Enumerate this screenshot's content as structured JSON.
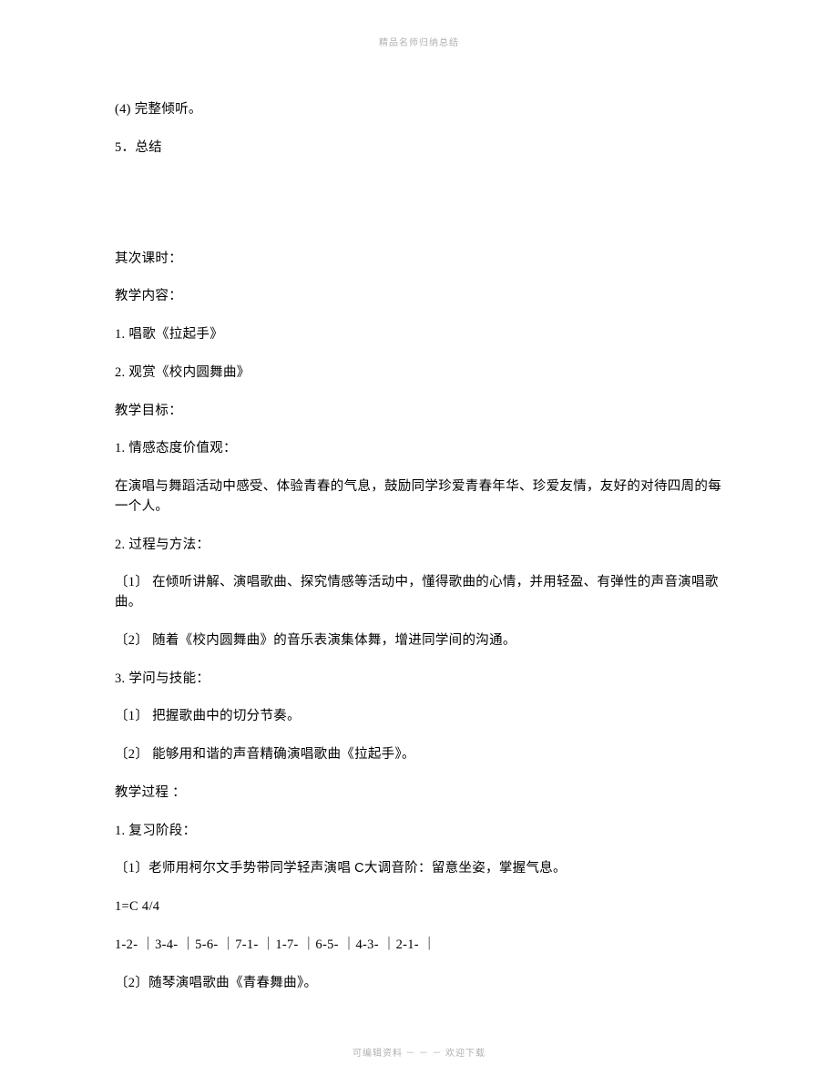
{
  "header_watermark": "精品名师归纳总结",
  "footer_watermark": "可编辑资料   －  －  －  欢迎下载",
  "lines": {
    "l1": "(4)    完整倾听。",
    "l2": "5．总结",
    "l3": "其次课时：",
    "l4": "教学内容：",
    "l5": "1. 唱歌《拉起手》",
    "l6": "2. 观赏《校内圆舞曲》",
    "l7": "教学目标：",
    "l8": "1. 情感态度价值观：",
    "l9": "在演唱与舞蹈活动中感受、体验青春的气息，鼓励同学珍爱青春年华、珍爱友情，友好的对待四周的每一个人。",
    "l10": "2. 过程与方法：",
    "l11": "〔1〕  在倾听讲解、演唱歌曲、探究情感等活动中，懂得歌曲的心情，并用轻盈、有弹性的声音演唱歌曲。",
    "l12": "〔2〕  随着《校内圆舞曲》的音乐表演集体舞，增进同学间的沟通。",
    "l13": "3. 学问与技能：",
    "l14": "〔1〕  把握歌曲中的切分节奏。",
    "l15": "〔2〕  能够用和谐的声音精确演唱歌曲《拉起手》。",
    "l16": "教学过程 ：",
    "l17": "1. 复习阶段：",
    "l18_a": "〔1〕老师用柯尔文手势带同学轻声演唱      ",
    "l18_b": "C",
    "l18_c": "大调音阶：留意坐姿，掌握气息。",
    "l19": "1=C 4/4",
    "l20": "1-2-  ｜3-4-  ｜5-6-  ｜7-1-  ｜1-7-  ｜6-5-  ｜4-3-  ｜2-1-  ｜",
    "l21": "〔2〕随琴演唱歌曲《青春舞曲》。"
  }
}
